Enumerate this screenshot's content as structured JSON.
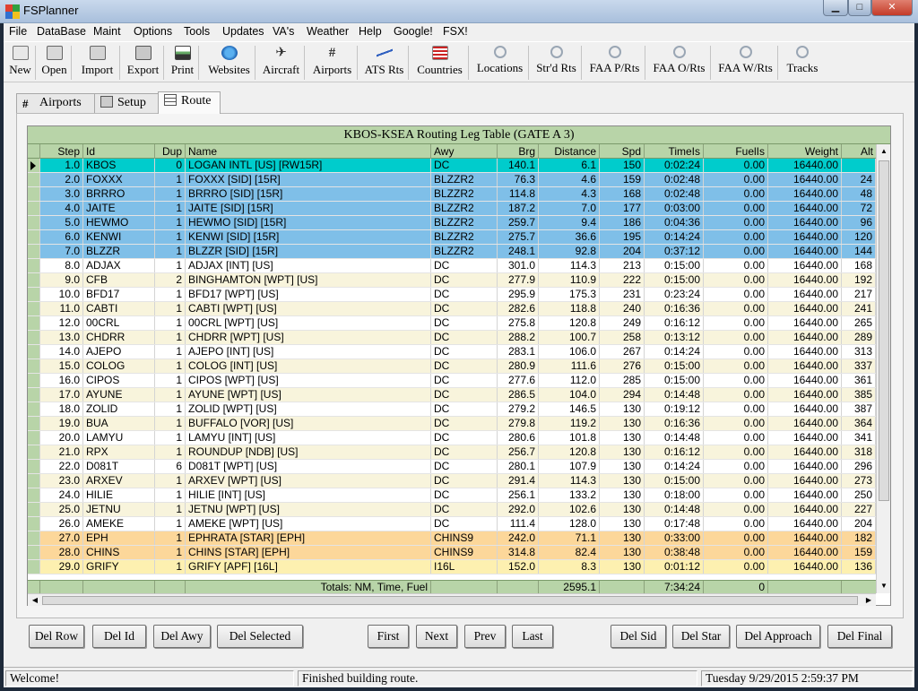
{
  "app": {
    "title": "FSPlanner"
  },
  "window_buttons": {
    "minimize": "▁",
    "maximize": "□",
    "close": "✕"
  },
  "menu": [
    "File",
    "DataBase",
    "Maint",
    "Options",
    "Tools",
    "Updates",
    "VA's",
    "Weather",
    "Help",
    "Google!",
    "FSX!"
  ],
  "toolbar": [
    {
      "label": "New",
      "icon": "new-doc-icon"
    },
    {
      "label": "Open",
      "icon": "open-icon"
    },
    {
      "label": "Import",
      "icon": "import-icon"
    },
    {
      "label": "Export",
      "icon": "export-icon"
    },
    {
      "label": "Print",
      "icon": "print-icon"
    },
    {
      "label": "Websites",
      "icon": "globe-icon"
    },
    {
      "label": "Aircraft",
      "icon": "aircraft-icon"
    },
    {
      "label": "Airports",
      "icon": "runway-icon"
    },
    {
      "label": "ATS Rts",
      "icon": "route-line-icon"
    },
    {
      "label": "Countries",
      "icon": "flag-icon"
    },
    {
      "label": "Locations",
      "icon": "magnifier-icon"
    },
    {
      "label": "Str'd Rts",
      "icon": "magnifier-icon"
    },
    {
      "label": "FAA P/Rts",
      "icon": "magnifier-icon"
    },
    {
      "label": "FAA O/Rts",
      "icon": "magnifier-icon"
    },
    {
      "label": "FAA W/Rts",
      "icon": "magnifier-icon"
    },
    {
      "label": "Tracks",
      "icon": "magnifier-icon"
    }
  ],
  "tabs": [
    {
      "label": "Airports",
      "icon": "runway-icon"
    },
    {
      "label": "Setup",
      "icon": "setup-icon"
    },
    {
      "label": "Route",
      "icon": "table-icon"
    }
  ],
  "grid": {
    "title": "KBOS-KSEA Routing Leg Table (GATE A 3)",
    "columns": [
      "Step",
      "Id",
      "Dup",
      "Name",
      "Awy",
      "Brg",
      "Distance",
      "Spd",
      "TimeIs",
      "FuelIs",
      "Weight",
      "Alt"
    ],
    "rows": [
      {
        "step": "1.0",
        "id": "KBOS",
        "dup": "0",
        "name": "LOGAN INTL [US] [RW15R]",
        "awy": "DC",
        "brg": "140.1",
        "dist": "6.1",
        "spd": "150",
        "time": "0:02:24",
        "fuel": "0.00",
        "weight": "16440.00",
        "alt": "",
        "kind": "selected"
      },
      {
        "step": "2.0",
        "id": "FOXXX",
        "dup": "1",
        "name": "FOXXX [SID] [15R]",
        "awy": "BLZZR2",
        "brg": "76.3",
        "dist": "4.6",
        "spd": "159",
        "time": "0:02:48",
        "fuel": "0.00",
        "weight": "16440.00",
        "alt": "24",
        "kind": "sid"
      },
      {
        "step": "3.0",
        "id": "BRRRO",
        "dup": "1",
        "name": "BRRRO [SID] [15R]",
        "awy": "BLZZR2",
        "brg": "114.8",
        "dist": "4.3",
        "spd": "168",
        "time": "0:02:48",
        "fuel": "0.00",
        "weight": "16440.00",
        "alt": "48",
        "kind": "sid"
      },
      {
        "step": "4.0",
        "id": "JAITE",
        "dup": "1",
        "name": "JAITE [SID] [15R]",
        "awy": "BLZZR2",
        "brg": "187.2",
        "dist": "7.0",
        "spd": "177",
        "time": "0:03:00",
        "fuel": "0.00",
        "weight": "16440.00",
        "alt": "72",
        "kind": "sid"
      },
      {
        "step": "5.0",
        "id": "HEWMO",
        "dup": "1",
        "name": "HEWMO [SID] [15R]",
        "awy": "BLZZR2",
        "brg": "259.7",
        "dist": "9.4",
        "spd": "186",
        "time": "0:04:36",
        "fuel": "0.00",
        "weight": "16440.00",
        "alt": "96",
        "kind": "sid"
      },
      {
        "step": "6.0",
        "id": "KENWI",
        "dup": "1",
        "name": "KENWI [SID] [15R]",
        "awy": "BLZZR2",
        "brg": "275.7",
        "dist": "36.6",
        "spd": "195",
        "time": "0:14:24",
        "fuel": "0.00",
        "weight": "16440.00",
        "alt": "120",
        "kind": "sid"
      },
      {
        "step": "7.0",
        "id": "BLZZR",
        "dup": "1",
        "name": "BLZZR [SID] [15R]",
        "awy": "BLZZR2",
        "brg": "248.1",
        "dist": "92.8",
        "spd": "204",
        "time": "0:37:12",
        "fuel": "0.00",
        "weight": "16440.00",
        "alt": "144",
        "kind": "sid"
      },
      {
        "step": "8.0",
        "id": "ADJAX",
        "dup": "1",
        "name": "ADJAX [INT] [US]",
        "awy": "DC",
        "brg": "301.0",
        "dist": "114.3",
        "spd": "213",
        "time": "0:15:00",
        "fuel": "0.00",
        "weight": "16440.00",
        "alt": "168",
        "kind": "white"
      },
      {
        "step": "9.0",
        "id": "CFB",
        "dup": "2",
        "name": "BINGHAMTON [WPT] [US]",
        "awy": "DC",
        "brg": "277.9",
        "dist": "110.9",
        "spd": "222",
        "time": "0:15:00",
        "fuel": "0.00",
        "weight": "16440.00",
        "alt": "192",
        "kind": "cream"
      },
      {
        "step": "10.0",
        "id": "BFD17",
        "dup": "1",
        "name": "BFD17 [WPT] [US]",
        "awy": "DC",
        "brg": "295.9",
        "dist": "175.3",
        "spd": "231",
        "time": "0:23:24",
        "fuel": "0.00",
        "weight": "16440.00",
        "alt": "217",
        "kind": "white"
      },
      {
        "step": "11.0",
        "id": "CABTI",
        "dup": "1",
        "name": "CABTI [WPT] [US]",
        "awy": "DC",
        "brg": "282.6",
        "dist": "118.8",
        "spd": "240",
        "time": "0:16:36",
        "fuel": "0.00",
        "weight": "16440.00",
        "alt": "241",
        "kind": "cream"
      },
      {
        "step": "12.0",
        "id": "00CRL",
        "dup": "1",
        "name": "00CRL [WPT] [US]",
        "awy": "DC",
        "brg": "275.8",
        "dist": "120.8",
        "spd": "249",
        "time": "0:16:12",
        "fuel": "0.00",
        "weight": "16440.00",
        "alt": "265",
        "kind": "white"
      },
      {
        "step": "13.0",
        "id": "CHDRR",
        "dup": "1",
        "name": "CHDRR [WPT] [US]",
        "awy": "DC",
        "brg": "288.2",
        "dist": "100.7",
        "spd": "258",
        "time": "0:13:12",
        "fuel": "0.00",
        "weight": "16440.00",
        "alt": "289",
        "kind": "cream"
      },
      {
        "step": "14.0",
        "id": "AJEPO",
        "dup": "1",
        "name": "AJEPO [INT] [US]",
        "awy": "DC",
        "brg": "283.1",
        "dist": "106.0",
        "spd": "267",
        "time": "0:14:24",
        "fuel": "0.00",
        "weight": "16440.00",
        "alt": "313",
        "kind": "white"
      },
      {
        "step": "15.0",
        "id": "COLOG",
        "dup": "1",
        "name": "COLOG [INT] [US]",
        "awy": "DC",
        "brg": "280.9",
        "dist": "111.6",
        "spd": "276",
        "time": "0:15:00",
        "fuel": "0.00",
        "weight": "16440.00",
        "alt": "337",
        "kind": "cream"
      },
      {
        "step": "16.0",
        "id": "CIPOS",
        "dup": "1",
        "name": "CIPOS [WPT] [US]",
        "awy": "DC",
        "brg": "277.6",
        "dist": "112.0",
        "spd": "285",
        "time": "0:15:00",
        "fuel": "0.00",
        "weight": "16440.00",
        "alt": "361",
        "kind": "white"
      },
      {
        "step": "17.0",
        "id": "AYUNE",
        "dup": "1",
        "name": "AYUNE [WPT] [US]",
        "awy": "DC",
        "brg": "286.5",
        "dist": "104.0",
        "spd": "294",
        "time": "0:14:48",
        "fuel": "0.00",
        "weight": "16440.00",
        "alt": "385",
        "kind": "cream"
      },
      {
        "step": "18.0",
        "id": "ZOLID",
        "dup": "1",
        "name": "ZOLID [WPT] [US]",
        "awy": "DC",
        "brg": "279.2",
        "dist": "146.5",
        "spd": "130",
        "time": "0:19:12",
        "fuel": "0.00",
        "weight": "16440.00",
        "alt": "387",
        "kind": "white"
      },
      {
        "step": "19.0",
        "id": "BUA",
        "dup": "1",
        "name": "BUFFALO [VOR] [US]",
        "awy": "DC",
        "brg": "279.8",
        "dist": "119.2",
        "spd": "130",
        "time": "0:16:36",
        "fuel": "0.00",
        "weight": "16440.00",
        "alt": "364",
        "kind": "cream"
      },
      {
        "step": "20.0",
        "id": "LAMYU",
        "dup": "1",
        "name": "LAMYU [INT] [US]",
        "awy": "DC",
        "brg": "280.6",
        "dist": "101.8",
        "spd": "130",
        "time": "0:14:48",
        "fuel": "0.00",
        "weight": "16440.00",
        "alt": "341",
        "kind": "white"
      },
      {
        "step": "21.0",
        "id": "RPX",
        "dup": "1",
        "name": "ROUNDUP [NDB] [US]",
        "awy": "DC",
        "brg": "256.7",
        "dist": "120.8",
        "spd": "130",
        "time": "0:16:12",
        "fuel": "0.00",
        "weight": "16440.00",
        "alt": "318",
        "kind": "cream"
      },
      {
        "step": "22.0",
        "id": "D081T",
        "dup": "6",
        "name": "D081T [WPT] [US]",
        "awy": "DC",
        "brg": "280.1",
        "dist": "107.9",
        "spd": "130",
        "time": "0:14:24",
        "fuel": "0.00",
        "weight": "16440.00",
        "alt": "296",
        "kind": "white"
      },
      {
        "step": "23.0",
        "id": "ARXEV",
        "dup": "1",
        "name": "ARXEV [WPT] [US]",
        "awy": "DC",
        "brg": "291.4",
        "dist": "114.3",
        "spd": "130",
        "time": "0:15:00",
        "fuel": "0.00",
        "weight": "16440.00",
        "alt": "273",
        "kind": "cream"
      },
      {
        "step": "24.0",
        "id": "HILIE",
        "dup": "1",
        "name": "HILIE [INT] [US]",
        "awy": "DC",
        "brg": "256.1",
        "dist": "133.2",
        "spd": "130",
        "time": "0:18:00",
        "fuel": "0.00",
        "weight": "16440.00",
        "alt": "250",
        "kind": "white"
      },
      {
        "step": "25.0",
        "id": "JETNU",
        "dup": "1",
        "name": "JETNU [WPT] [US]",
        "awy": "DC",
        "brg": "292.0",
        "dist": "102.6",
        "spd": "130",
        "time": "0:14:48",
        "fuel": "0.00",
        "weight": "16440.00",
        "alt": "227",
        "kind": "cream"
      },
      {
        "step": "26.0",
        "id": "AMEKE",
        "dup": "1",
        "name": "AMEKE [WPT] [US]",
        "awy": "DC",
        "brg": "111.4",
        "dist": "128.0",
        "spd": "130",
        "time": "0:17:48",
        "fuel": "0.00",
        "weight": "16440.00",
        "alt": "204",
        "kind": "white"
      },
      {
        "step": "27.0",
        "id": "EPH",
        "dup": "1",
        "name": "EPHRATA [STAR] [EPH]",
        "awy": "CHINS9",
        "brg": "242.0",
        "dist": "71.1",
        "spd": "130",
        "time": "0:33:00",
        "fuel": "0.00",
        "weight": "16440.00",
        "alt": "182",
        "kind": "star"
      },
      {
        "step": "28.0",
        "id": "CHINS",
        "dup": "1",
        "name": "CHINS [STAR] [EPH]",
        "awy": "CHINS9",
        "brg": "314.8",
        "dist": "82.4",
        "spd": "130",
        "time": "0:38:48",
        "fuel": "0.00",
        "weight": "16440.00",
        "alt": "159",
        "kind": "star"
      },
      {
        "step": "29.0",
        "id": "GRIFY",
        "dup": "1",
        "name": "GRIFY [APF] [16L]",
        "awy": "I16L",
        "brg": "152.0",
        "dist": "8.3",
        "spd": "130",
        "time": "0:01:12",
        "fuel": "0.00",
        "weight": "16440.00",
        "alt": "136",
        "kind": "app"
      }
    ],
    "totals": {
      "label": "Totals: NM, Time, Fuel",
      "distance": "2595.1",
      "time": "7:34:24",
      "fuel": "0"
    }
  },
  "row_colors": {
    "selected": "#00cccc",
    "sid": "#7fbfe8",
    "white": "#ffffff",
    "cream": "#f8f4dc",
    "star": "#fcd79a",
    "app": "#fdf0b0"
  },
  "buttons": [
    "Del Row",
    "Del Id",
    "Del Awy",
    "Del Selected",
    "First",
    "Next",
    "Prev",
    "Last",
    "Del Sid",
    "Del Star",
    "Del Approach",
    "Del Final"
  ],
  "status": {
    "left": "Welcome!",
    "middle": "Finished building route.",
    "right": "Tuesday 9/29/2015 2:59:37 PM"
  }
}
